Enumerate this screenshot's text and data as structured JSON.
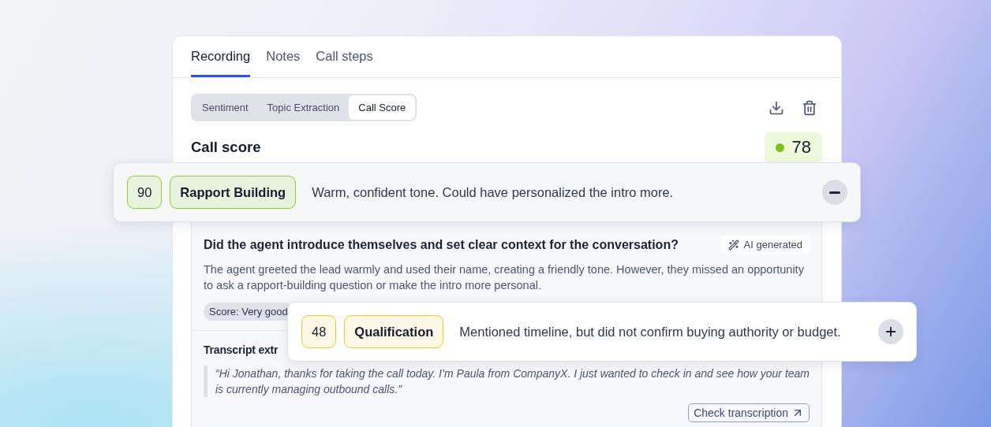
{
  "tabs": [
    {
      "label": "Recording",
      "selected": true
    },
    {
      "label": "Notes",
      "selected": false
    },
    {
      "label": "Call steps",
      "selected": false
    }
  ],
  "views": [
    {
      "label": "Sentiment",
      "selected": false
    },
    {
      "label": "Topic Extraction",
      "selected": false
    },
    {
      "label": "Call Score",
      "selected": true
    }
  ],
  "call_score": {
    "title": "Call score",
    "score": "78",
    "color": "#7cc21e"
  },
  "criteria": [
    {
      "score": "90",
      "name": "Rapport Building",
      "summary": "Warm, confident tone. Could have personalized the intro more.",
      "color": "#8ccf2e",
      "expanded": true
    },
    {
      "score": "48",
      "name": "Qualification",
      "summary": "Mentioned timeline, but did not confirm buying authority or budget.",
      "color": "#f0c53c",
      "expanded": false
    }
  ],
  "detail": {
    "question": "Did the agent introduce themselves and set clear context for the conversation?",
    "badge": "AI generated",
    "explanation": "The agent greeted the lead warmly and used their name, creating a friendly tone. However, they missed an opportunity to ask a rapport-building question or make the intro more personal.",
    "rating": "Score: Very good",
    "transcript_title": "Transcript extr",
    "quote": "“Hi Jonathan, thanks for taking the call today. I’m Paula from CompanyX. I just wanted to check in and see how your team is currently managing outbound calls.”",
    "link": "Check transcription"
  }
}
